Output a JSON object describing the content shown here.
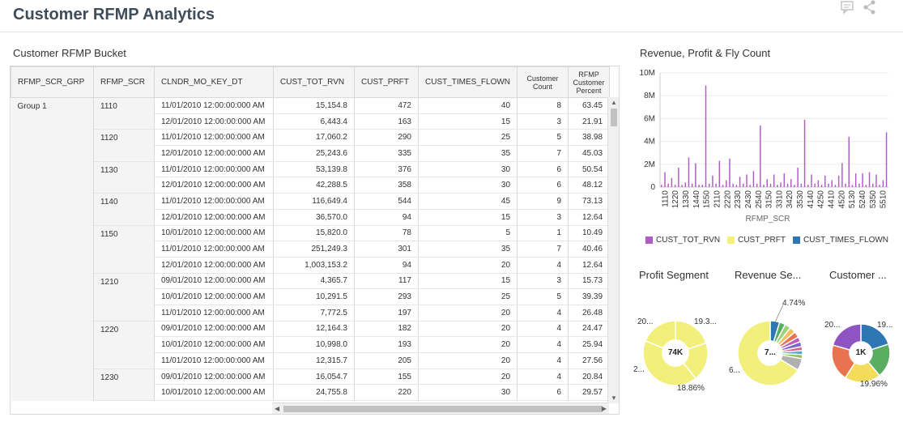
{
  "header": {
    "title": "Customer RFMP Analytics",
    "comment_icon": "comment-icon",
    "share_icon": "share-icon"
  },
  "table_panel": {
    "title": "Customer RFMP Bucket",
    "columns": [
      "RFMP_SCR_GRP",
      "RFMP_SCR",
      "CLNDR_MO_KEY_DT",
      "CUST_TOT_RVN",
      "CUST_PRFT",
      "CUST_TIMES_FLOWN",
      "Customer Count",
      "RFMP Customer Percent"
    ],
    "group": "Group 1",
    "rows": [
      {
        "scr": "1110",
        "date": "11/01/2010 12:00:00:000 AM",
        "rvn": "15,154.8",
        "prft": "472",
        "flown": "40",
        "count": "8",
        "pct": "63.45"
      },
      {
        "scr": "",
        "date": "12/01/2010 12:00:00:000 AM",
        "rvn": "6,443.4",
        "prft": "163",
        "flown": "15",
        "count": "3",
        "pct": "21.91"
      },
      {
        "scr": "1120",
        "date": "11/01/2010 12:00:00:000 AM",
        "rvn": "17,060.2",
        "prft": "290",
        "flown": "25",
        "count": "5",
        "pct": "38.98"
      },
      {
        "scr": "",
        "date": "12/01/2010 12:00:00:000 AM",
        "rvn": "25,243.6",
        "prft": "335",
        "flown": "35",
        "count": "7",
        "pct": "45.03"
      },
      {
        "scr": "1130",
        "date": "11/01/2010 12:00:00:000 AM",
        "rvn": "53,139.8",
        "prft": "376",
        "flown": "30",
        "count": "6",
        "pct": "50.54"
      },
      {
        "scr": "",
        "date": "12/01/2010 12:00:00:000 AM",
        "rvn": "42,288.5",
        "prft": "358",
        "flown": "30",
        "count": "6",
        "pct": "48.12"
      },
      {
        "scr": "1140",
        "date": "11/01/2010 12:00:00:000 AM",
        "rvn": "116,649.4",
        "prft": "544",
        "flown": "45",
        "count": "9",
        "pct": "73.13"
      },
      {
        "scr": "",
        "date": "12/01/2010 12:00:00:000 AM",
        "rvn": "36,570.0",
        "prft": "94",
        "flown": "15",
        "count": "3",
        "pct": "12.64"
      },
      {
        "scr": "1150",
        "date": "10/01/2010 12:00:00:000 AM",
        "rvn": "15,820.0",
        "prft": "78",
        "flown": "5",
        "count": "1",
        "pct": "10.49"
      },
      {
        "scr": "",
        "date": "11/01/2010 12:00:00:000 AM",
        "rvn": "251,249.3",
        "prft": "301",
        "flown": "35",
        "count": "7",
        "pct": "40.46"
      },
      {
        "scr": "",
        "date": "12/01/2010 12:00:00:000 AM",
        "rvn": "1,003,153.2",
        "prft": "94",
        "flown": "20",
        "count": "4",
        "pct": "12.64"
      },
      {
        "scr": "1210",
        "date": "09/01/2010 12:00:00:000 AM",
        "rvn": "4,365.7",
        "prft": "117",
        "flown": "15",
        "count": "3",
        "pct": "15.73"
      },
      {
        "scr": "",
        "date": "10/01/2010 12:00:00:000 AM",
        "rvn": "10,291.5",
        "prft": "293",
        "flown": "25",
        "count": "5",
        "pct": "39.39"
      },
      {
        "scr": "",
        "date": "11/01/2010 12:00:00:000 AM",
        "rvn": "7,772.5",
        "prft": "197",
        "flown": "20",
        "count": "4",
        "pct": "26.48"
      },
      {
        "scr": "1220",
        "date": "09/01/2010 12:00:00:000 AM",
        "rvn": "12,164.3",
        "prft": "182",
        "flown": "20",
        "count": "4",
        "pct": "24.47"
      },
      {
        "scr": "",
        "date": "10/01/2010 12:00:00:000 AM",
        "rvn": "10,998.0",
        "prft": "193",
        "flown": "20",
        "count": "4",
        "pct": "25.94"
      },
      {
        "scr": "",
        "date": "11/01/2010 12:00:00:000 AM",
        "rvn": "12,315.7",
        "prft": "205",
        "flown": "20",
        "count": "4",
        "pct": "27.56"
      },
      {
        "scr": "1230",
        "date": "09/01/2010 12:00:00:000 AM",
        "rvn": "16,054.7",
        "prft": "155",
        "flown": "20",
        "count": "4",
        "pct": "20.84"
      },
      {
        "scr": "",
        "date": "10/01/2010 12:00:00:000 AM",
        "rvn": "24,755.8",
        "prft": "220",
        "flown": "30",
        "count": "6",
        "pct": "29.57"
      }
    ]
  },
  "chart_data": [
    {
      "type": "bar",
      "title": "Revenue, Profit & Fly Count",
      "xlabel": "RFMP_SCR",
      "ylabel": "",
      "ylim": [
        0,
        10000000
      ],
      "y_ticks": [
        "0",
        "2M",
        "4M",
        "6M",
        "8M",
        "10M"
      ],
      "x_tick_labels": [
        "1110",
        "1220",
        "1330",
        "1440",
        "1550",
        "2110",
        "2220",
        "2330",
        "2430",
        "2540",
        "3150",
        "3310",
        "3420",
        "3530",
        "4140",
        "4250",
        "4410",
        "4520",
        "5130",
        "5240",
        "5350",
        "5510"
      ],
      "legend": [
        "CUST_TOT_RVN",
        "CUST_PRFT",
        "CUST_TIMES_FLOWN"
      ],
      "colors": [
        "#b05cc6",
        "#f2ef7a",
        "#2f77b4"
      ],
      "legend_position": "bottom",
      "series": [
        {
          "name": "CUST_TOT_RVN",
          "values": [
            200000,
            1300000,
            300000,
            800000,
            200000,
            1700000,
            200000,
            400000,
            2600000,
            300000,
            2100000,
            200000,
            200000,
            8900000,
            300000,
            1000000,
            300000,
            2300000,
            200000,
            600000,
            2500000,
            300000,
            200000,
            900000,
            300000,
            1100000,
            200000,
            1400000,
            300000,
            5400000,
            200000,
            700000,
            300000,
            1100000,
            200000,
            400000,
            1200000,
            300000,
            700000,
            200000,
            1700000,
            300000,
            5900000,
            200000,
            1100000,
            300000,
            600000,
            200000,
            1000000,
            300000,
            600000,
            200000,
            1000000,
            2100000,
            300000,
            4400000,
            200000,
            1200000,
            300000,
            1200000,
            200000,
            1300000,
            300000,
            1100000,
            200000,
            600000,
            4800000
          ]
        }
      ]
    },
    {
      "type": "pie",
      "title": "Profit Segment",
      "center_label": "74K",
      "labels": [
        "20...",
        "19.3...",
        "2...",
        "18.86%"
      ],
      "values": [
        20,
        19.3,
        42,
        18.86
      ],
      "colors": [
        "#f2ef7a",
        "#f2ef7a",
        "#f2ef7a",
        "#f2ef7a"
      ]
    },
    {
      "type": "pie",
      "title": "Revenue Se...",
      "center_label": "7...",
      "labels": [
        "4.74%",
        "6..."
      ],
      "values": [
        4.74,
        3,
        3,
        3,
        3,
        2.5,
        2.5,
        2,
        2,
        2,
        6,
        66.26
      ],
      "colors": [
        "#2f77b4",
        "#5aae61",
        "#9bd37b",
        "#f0c05a",
        "#e9734f",
        "#c15bbf",
        "#7b68c8",
        "#d95f8e",
        "#4fa8d8",
        "#8bc34a",
        "#b0b0b0",
        "#f2ef7a"
      ]
    },
    {
      "type": "pie",
      "title": "Customer ...",
      "center_label": "1K",
      "labels": [
        "20...",
        "19...",
        "19.96%"
      ],
      "values": [
        20,
        19,
        19.96,
        20.5,
        20.54
      ],
      "colors": [
        "#2f77b4",
        "#5aae61",
        "#f2dc5a",
        "#e9734f",
        "#8e54c2"
      ]
    }
  ]
}
